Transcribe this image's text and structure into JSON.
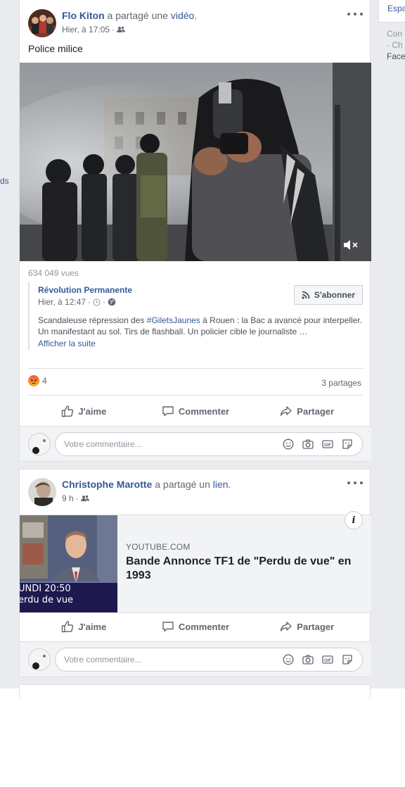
{
  "left_nav": {
    "stub_text": "ds"
  },
  "right_column": {
    "box_text": "Espa",
    "footer_lines": [
      "Con",
      "· Ch",
      "Face"
    ]
  },
  "posts": [
    {
      "author": "Flo Kiton",
      "action_prefix": "a partagé une",
      "action_link": "vidéo",
      "action_suffix": ".",
      "time": "Hier, à 17:05",
      "audience_sep": "·",
      "text": "Police milice",
      "video_views": "634 049 vues",
      "shared": {
        "page_name": "Révolution Permanente",
        "time": "Hier, à 12:47",
        "subscribe_label": "S'abonner",
        "text_before": "Scandaleuse répression des ",
        "hashtag": "#GiletsJaunes",
        "text_after": " à Rouen : la Bac a avancé pour interpeller. Un manifestant au sol. Tirs de flashball. Un policier cible le journaliste …",
        "see_more": "Afficher la suite"
      },
      "reaction_count": "4",
      "shares": "3 partages",
      "actions": {
        "like": "J'aime",
        "comment": "Commenter",
        "share": "Partager"
      },
      "comment_placeholder": "Votre commentaire..."
    },
    {
      "author": "Christophe Marotte",
      "action_prefix": "a partagé un",
      "action_link": "lien",
      "action_suffix": ".",
      "time": "9 h",
      "audience_sep": "·",
      "link": {
        "domain": "YOUTUBE.COM",
        "title": "Bande Annonce TF1 de \"Perdu de vue\" en 1993",
        "thumb_lines": [
          "UNDI  20:50",
          "erdu de vue"
        ]
      },
      "actions": {
        "like": "J'aime",
        "comment": "Commenter",
        "share": "Partager"
      },
      "comment_placeholder": "Votre commentaire..."
    }
  ],
  "colors": {
    "link_blue": "#365899",
    "feed_bg": "#e9ebee",
    "muted": "#606770"
  }
}
